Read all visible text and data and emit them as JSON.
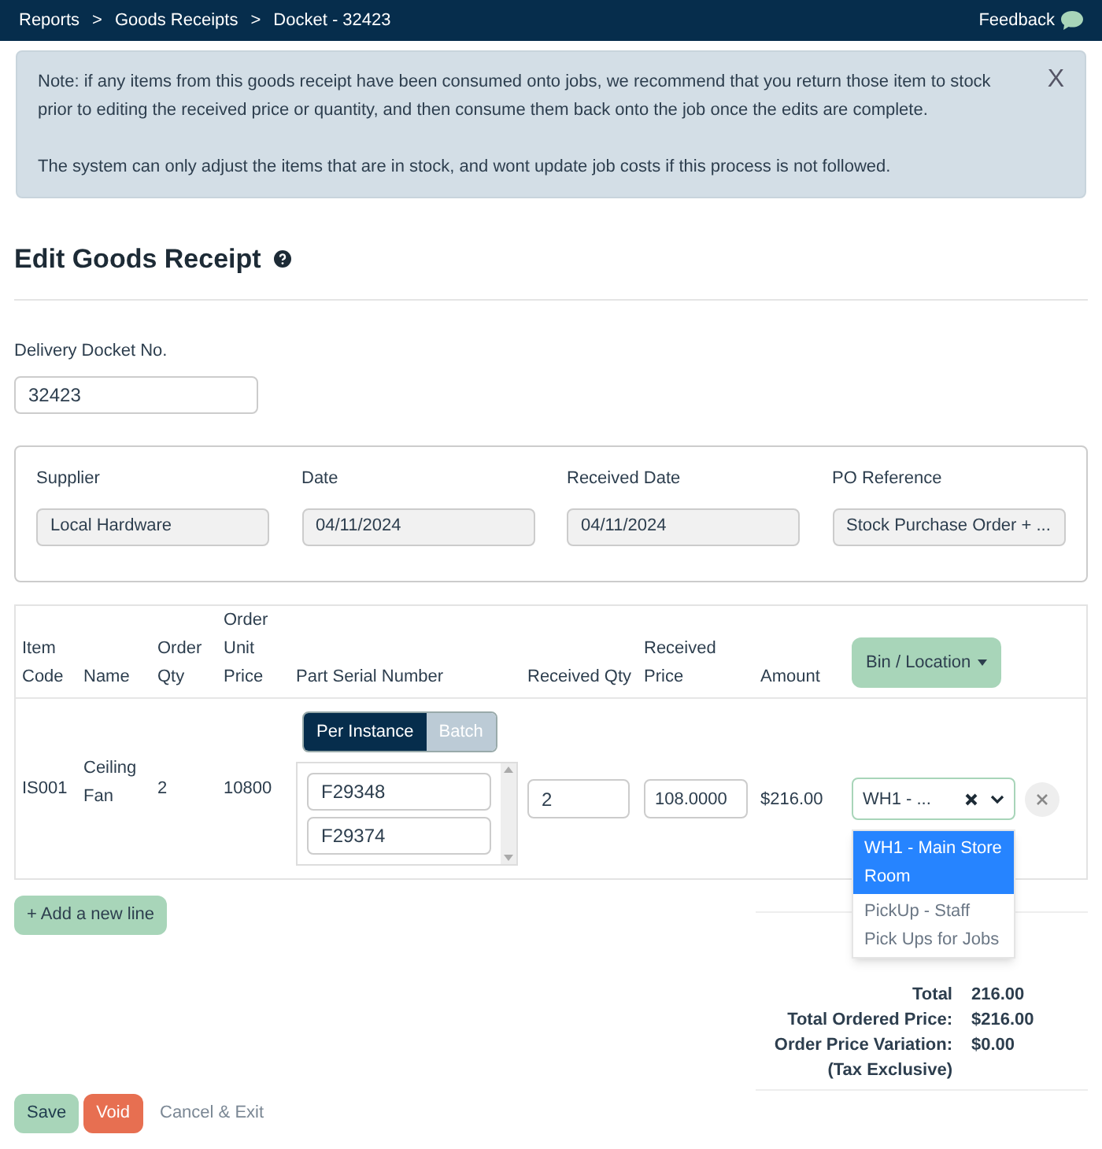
{
  "breadcrumbs": [
    "Reports",
    "Goods Receipts",
    "Docket - 32423"
  ],
  "breadcrumb_separator": ">",
  "feedback": "Feedback",
  "alert": {
    "paragraphs": [
      "Note: if any items from this goods receipt have been consumed onto jobs, we recommend that you return those item to stock prior to editing the received price or quantity, and then consume them back onto the job once the edits are complete.",
      "The system can only adjust the items that are in stock, and wont update job costs if this process is not followed."
    ],
    "close": "X"
  },
  "title": "Edit Goods Receipt",
  "delivery_docket": {
    "label": "Delivery Docket No.",
    "value": "32423"
  },
  "details": [
    {
      "label": "Supplier",
      "value": "Local Hardware"
    },
    {
      "label": "Date",
      "value": "04/11/2024"
    },
    {
      "label": "Received Date",
      "value": "04/11/2024"
    },
    {
      "label": "PO Reference",
      "value": "Stock Purchase Order + ..."
    }
  ],
  "table": {
    "columns": [
      "Item Code",
      "Name",
      "Order Qty",
      "Order Unit Price",
      "Part Serial Number",
      "Received Qty",
      "Received Price",
      "Amount"
    ],
    "bin_button": "Bin / Location",
    "rows": [
      {
        "item_code": "IS001",
        "name": "Ceiling Fan",
        "order_qty": "2",
        "order_unit_price": "10800",
        "serial_modes": [
          {
            "label": "Per Instance",
            "selected": true
          },
          {
            "label": "Batch",
            "selected": false
          }
        ],
        "serials": [
          "F29348",
          "F29374"
        ],
        "received_qty": "2",
        "received_price": "108.0000",
        "amount": "$216.00",
        "location": {
          "value": "WH1 - ...",
          "expanded": true,
          "options": [
            {
              "label": "WH1 - Main Store Room",
              "selected": true
            },
            {
              "label": "PickUp - Staff Pick Ups for Jobs",
              "selected": false
            }
          ]
        }
      }
    ]
  },
  "add_line": "+ Add a new line",
  "totals": [
    {
      "label": "Total",
      "value": "216.00"
    },
    {
      "label": "Total Ordered Price:",
      "value": "$216.00"
    },
    {
      "label": "Order Price Variation:",
      "value": "$0.00"
    },
    {
      "label": "(Tax Exclusive)"
    }
  ],
  "actions": [
    {
      "label": "Save",
      "kind": "save"
    },
    {
      "label": "Void",
      "kind": "danger"
    },
    {
      "label": "Cancel & Exit",
      "kind": "link"
    }
  ]
}
